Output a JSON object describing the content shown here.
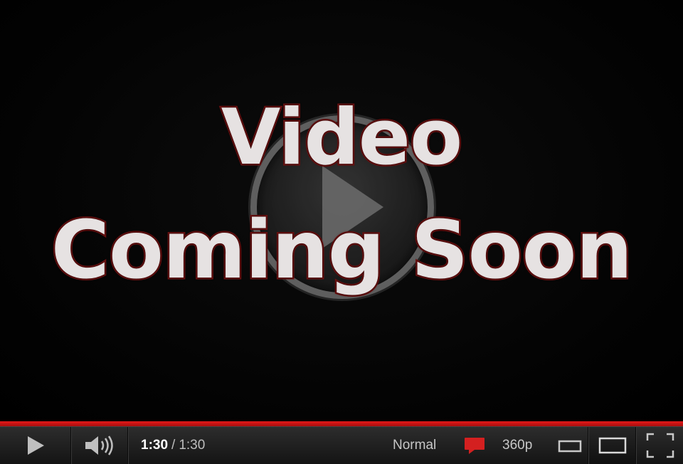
{
  "video": {
    "headline_line1": "Video",
    "headline_line2": "Coming Soon",
    "center_icon": "play-circle-icon"
  },
  "progress": {
    "played_fraction": 1.0,
    "color": "#e31919"
  },
  "controls": {
    "play_icon": "play-icon",
    "volume_icon": "volume-icon",
    "current_time": "1:30",
    "separator": "/",
    "duration": "1:30",
    "speed_label": "Normal",
    "captions_icon": "captions-icon",
    "quality_label": "360p",
    "small_player_icon": "small-player-icon",
    "large_player_icon": "large-player-icon",
    "fullscreen_icon": "fullscreen-icon"
  },
  "colors": {
    "headline_fill": "#e6e2e2",
    "headline_outline": "#6b1212",
    "captions_icon": "#d42020"
  }
}
